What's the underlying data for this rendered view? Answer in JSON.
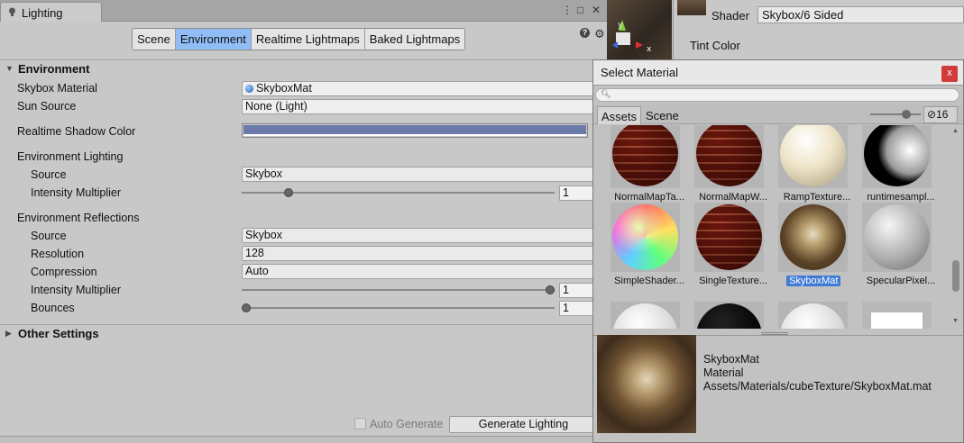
{
  "window": {
    "tab_title": "Lighting",
    "tabs": [
      {
        "label": "Scene",
        "active": false
      },
      {
        "label": "Environment",
        "active": true
      },
      {
        "label": "Realtime Lightmaps",
        "active": false
      },
      {
        "label": "Baked Lightmaps",
        "active": false
      }
    ]
  },
  "environment": {
    "header": "Environment",
    "skybox_material_label": "Skybox Material",
    "skybox_material_value": "SkyboxMat",
    "sun_source_label": "Sun Source",
    "sun_source_value": "None (Light)",
    "realtime_shadow_color_label": "Realtime Shadow Color",
    "realtime_shadow_color": "#6b7aa6",
    "lighting_header": "Environment Lighting",
    "lighting_source_label": "Source",
    "lighting_source_value": "Skybox",
    "lighting_intensity_label": "Intensity Multiplier",
    "lighting_intensity_value": "1",
    "lighting_intensity_fraction": 0.14,
    "reflections_header": "Environment Reflections",
    "reflections_source_label": "Source",
    "reflections_source_value": "Skybox",
    "resolution_label": "Resolution",
    "resolution_value": "128",
    "compression_label": "Compression",
    "compression_value": "Auto",
    "reflections_intensity_label": "Intensity Multiplier",
    "reflections_intensity_value": "1",
    "reflections_intensity_fraction": 1.0,
    "bounces_label": "Bounces",
    "bounces_value": "1",
    "bounces_fraction": 0.0
  },
  "other_settings": {
    "header": "Other Settings"
  },
  "footer": {
    "auto_generate_label": "Auto Generate",
    "generate_button": "Generate Lighting"
  },
  "inspector": {
    "shader_label": "Shader",
    "shader_value": "Skybox/6 Sided",
    "tint_color_label": "Tint Color"
  },
  "select_material": {
    "title": "Select Material",
    "close_label": "x",
    "search_placeholder": "",
    "tabs": [
      {
        "label": "Assets",
        "active": true
      },
      {
        "label": "Scene",
        "active": false
      }
    ],
    "hidden_count": "16",
    "items": [
      {
        "name": "NormalMapTa...",
        "style": "brick",
        "selected": false
      },
      {
        "name": "NormalMapW...",
        "style": "brick",
        "selected": false
      },
      {
        "name": "RampTexture...",
        "style": "cream",
        "selected": false
      },
      {
        "name": "runtimesampl...",
        "style": "black-white",
        "selected": false
      },
      {
        "name": "SimpleShader...",
        "style": "rainbow",
        "selected": false
      },
      {
        "name": "SingleTexture...",
        "style": "brick",
        "selected": false
      },
      {
        "name": "SkyboxMat",
        "style": "skybox",
        "selected": true
      },
      {
        "name": "SpecularPixel...",
        "style": "grey",
        "selected": false
      },
      {
        "name": "",
        "style": "white",
        "selected": false
      },
      {
        "name": "",
        "style": "black",
        "selected": false
      },
      {
        "name": "",
        "style": "white",
        "selected": false
      },
      {
        "name": "",
        "style": "white-square",
        "selected": false
      }
    ],
    "preview": {
      "name": "SkyboxMat",
      "type": "Material",
      "path": "Assets/Materials/cubeTexture/SkyboxMat.mat"
    }
  }
}
